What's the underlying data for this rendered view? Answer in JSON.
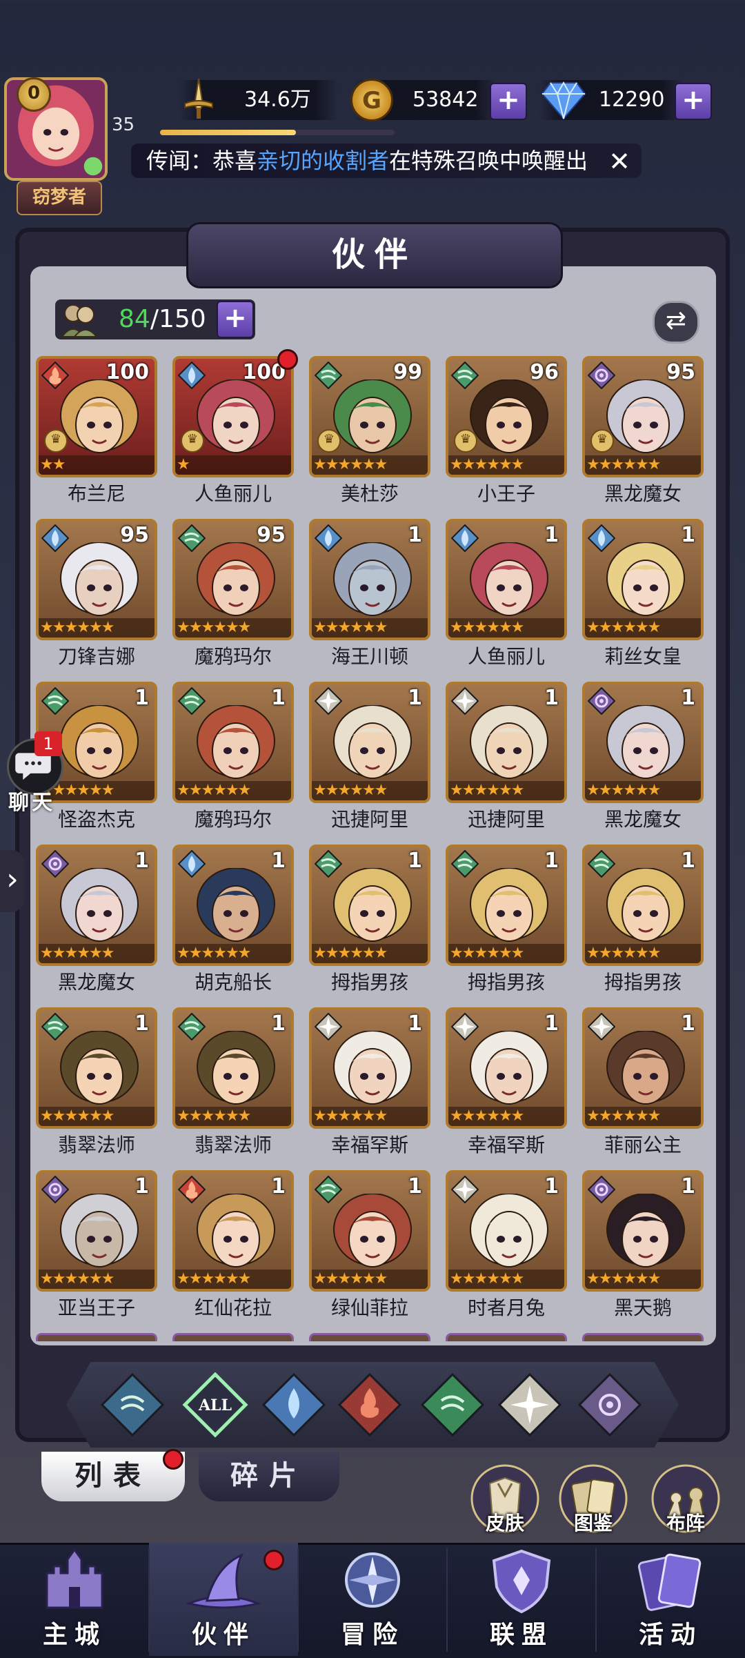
{
  "player": {
    "vip": "0",
    "level": "35",
    "title": "窃梦者",
    "xp_fraction": 0.58
  },
  "resources": {
    "power": "34.6万",
    "gold": "53842",
    "gems": "12290",
    "plus": "+"
  },
  "news": {
    "prefix": "传闻：恭喜",
    "highlight": "亲切的收割者",
    "suffix": "在特殊召唤中唤醒出",
    "close": "✕"
  },
  "panel": {
    "title": "伙伴",
    "count_current": "84",
    "count_max": "/150",
    "swap": "⇄"
  },
  "heroes": [
    {
      "name": "布兰尼",
      "level": "100",
      "stars": 2,
      "element": "fire",
      "red": true,
      "crown": true,
      "hair": "#d4a45a",
      "skin": "#f2d2b0"
    },
    {
      "name": "人鱼丽儿",
      "level": "100",
      "stars": 1,
      "element": "water",
      "red": true,
      "crown": true,
      "hair": "#b84a5a",
      "skin": "#f0d4c4",
      "dot": true
    },
    {
      "name": "美杜莎",
      "level": "99",
      "stars": 6,
      "element": "wind",
      "red": false,
      "crown": true,
      "hair": "#4a8a4a",
      "skin": "#e8c8a8"
    },
    {
      "name": "小王子",
      "level": "96",
      "stars": 6,
      "element": "wind",
      "red": false,
      "crown": true,
      "hair": "#3a2418",
      "skin": "#f0cca8"
    },
    {
      "name": "黑龙魔女",
      "level": "95",
      "stars": 6,
      "element": "dark",
      "red": false,
      "crown": true,
      "hair": "#c8c8d4",
      "skin": "#f0d8d0"
    },
    {
      "name": "刀锋吉娜",
      "level": "95",
      "stars": 6,
      "element": "water",
      "red": false,
      "crown": false,
      "hair": "#e8e8ee",
      "skin": "#e8d0c0"
    },
    {
      "name": "魔鸦玛尔",
      "level": "95",
      "stars": 6,
      "element": "wind",
      "red": false,
      "crown": false,
      "hair": "#b4523a",
      "skin": "#f0d0b8"
    },
    {
      "name": "海王川顿",
      "level": "1",
      "stars": 6,
      "element": "water",
      "red": false,
      "crown": false,
      "hair": "#9aa4b8",
      "skin": "#b8c4d0"
    },
    {
      "name": "人鱼丽儿",
      "level": "1",
      "stars": 6,
      "element": "water",
      "red": false,
      "crown": false,
      "hair": "#b84a5a",
      "skin": "#f0d4c4"
    },
    {
      "name": "莉丝女皇",
      "level": "1",
      "stars": 6,
      "element": "water",
      "red": false,
      "crown": false,
      "hair": "#e8d088",
      "skin": "#f4dcc8"
    },
    {
      "name": "怪盗杰克",
      "level": "1",
      "stars": 6,
      "element": "wind",
      "red": false,
      "crown": false,
      "hair": "#c89240",
      "skin": "#f0cca8"
    },
    {
      "name": "魔鸦玛尔",
      "level": "1",
      "stars": 6,
      "element": "wind",
      "red": false,
      "crown": false,
      "hair": "#b4523a",
      "skin": "#f0d0b8"
    },
    {
      "name": "迅捷阿里",
      "level": "1",
      "stars": 6,
      "element": "light",
      "red": false,
      "crown": false,
      "hair": "#e8e0cc",
      "skin": "#f0d4b8"
    },
    {
      "name": "迅捷阿里",
      "level": "1",
      "stars": 6,
      "element": "light",
      "red": false,
      "crown": false,
      "hair": "#e8e0cc",
      "skin": "#f0d4b8"
    },
    {
      "name": "黑龙魔女",
      "level": "1",
      "stars": 6,
      "element": "dark",
      "red": false,
      "crown": false,
      "hair": "#c8c8d4",
      "skin": "#f0d8d0"
    },
    {
      "name": "黑龙魔女",
      "level": "1",
      "stars": 6,
      "element": "dark",
      "red": false,
      "crown": false,
      "hair": "#c8c8d4",
      "skin": "#f0d8d0"
    },
    {
      "name": "胡克船长",
      "level": "1",
      "stars": 6,
      "element": "water",
      "red": false,
      "crown": false,
      "hair": "#2a3a5a",
      "skin": "#d8b090"
    },
    {
      "name": "拇指男孩",
      "level": "1",
      "stars": 6,
      "element": "wind",
      "red": false,
      "crown": false,
      "hair": "#e0c070",
      "skin": "#f4d4b4"
    },
    {
      "name": "拇指男孩",
      "level": "1",
      "stars": 6,
      "element": "wind",
      "red": false,
      "crown": false,
      "hair": "#e0c070",
      "skin": "#f4d4b4"
    },
    {
      "name": "拇指男孩",
      "level": "1",
      "stars": 6,
      "element": "wind",
      "red": false,
      "crown": false,
      "hair": "#e0c070",
      "skin": "#f4d4b4"
    },
    {
      "name": "翡翠法师",
      "level": "1",
      "stars": 6,
      "element": "wind",
      "red": false,
      "crown": false,
      "hair": "#5a4a2a",
      "skin": "#f4d4b4"
    },
    {
      "name": "翡翠法师",
      "level": "1",
      "stars": 6,
      "element": "wind",
      "red": false,
      "crown": false,
      "hair": "#5a4a2a",
      "skin": "#f4d4b4"
    },
    {
      "name": "幸福罕斯",
      "level": "1",
      "stars": 6,
      "element": "light",
      "red": false,
      "crown": false,
      "hair": "#f0ece4",
      "skin": "#f0d4c0"
    },
    {
      "name": "幸福罕斯",
      "level": "1",
      "stars": 6,
      "element": "light",
      "red": false,
      "crown": false,
      "hair": "#f0ece4",
      "skin": "#f0d4c0"
    },
    {
      "name": "菲丽公主",
      "level": "1",
      "stars": 6,
      "element": "light",
      "red": false,
      "crown": false,
      "hair": "#5a3a2a",
      "skin": "#d8a888"
    },
    {
      "name": "亚当王子",
      "level": "1",
      "stars": 6,
      "element": "dark",
      "red": false,
      "crown": false,
      "hair": "#d0d0d4",
      "skin": "#c8b8a8"
    },
    {
      "name": "红仙花拉",
      "level": "1",
      "stars": 6,
      "element": "fire",
      "red": false,
      "crown": false,
      "hair": "#c89a5a",
      "skin": "#f4d8c4"
    },
    {
      "name": "绿仙菲拉",
      "level": "1",
      "stars": 6,
      "element": "wind",
      "red": false,
      "crown": false,
      "hair": "#a84a3a",
      "skin": "#f4d8c4"
    },
    {
      "name": "时者月兔",
      "level": "1",
      "stars": 6,
      "element": "light",
      "red": false,
      "crown": false,
      "hair": "#f0e8d8",
      "skin": "#f0e8d8"
    },
    {
      "name": "黑天鹅",
      "level": "1",
      "stars": 6,
      "element": "dark",
      "red": false,
      "crown": false,
      "hair": "#2a1e24",
      "skin": "#f0d4c4"
    }
  ],
  "filters": [
    {
      "id": "wind-a",
      "label": ""
    },
    {
      "id": "all",
      "label": "ALL"
    },
    {
      "id": "water",
      "label": ""
    },
    {
      "id": "fire",
      "label": ""
    },
    {
      "id": "wind",
      "label": ""
    },
    {
      "id": "light",
      "label": ""
    },
    {
      "id": "dark",
      "label": ""
    }
  ],
  "tabs": {
    "list": "列表",
    "fragments": "碎片"
  },
  "side_buttons": {
    "skin": "皮肤",
    "codex": "图鉴",
    "formation": "布阵"
  },
  "chat": {
    "label": "聊天",
    "badge": "1"
  },
  "nav": [
    {
      "label": "主城",
      "icon": "castle-icon"
    },
    {
      "label": "伙伴",
      "icon": "witch-hat-icon"
    },
    {
      "label": "冒险",
      "icon": "compass-icon"
    },
    {
      "label": "联盟",
      "icon": "shield-icon"
    },
    {
      "label": "活动",
      "icon": "cards-icon"
    }
  ],
  "colors": {
    "accent_purple": "#6b4fc0",
    "gold": "#e8b64a",
    "star": "#f4a72c",
    "notify_red": "#e0202a",
    "count_green": "#4fdb5a",
    "news_highlight": "#56a5ff"
  }
}
